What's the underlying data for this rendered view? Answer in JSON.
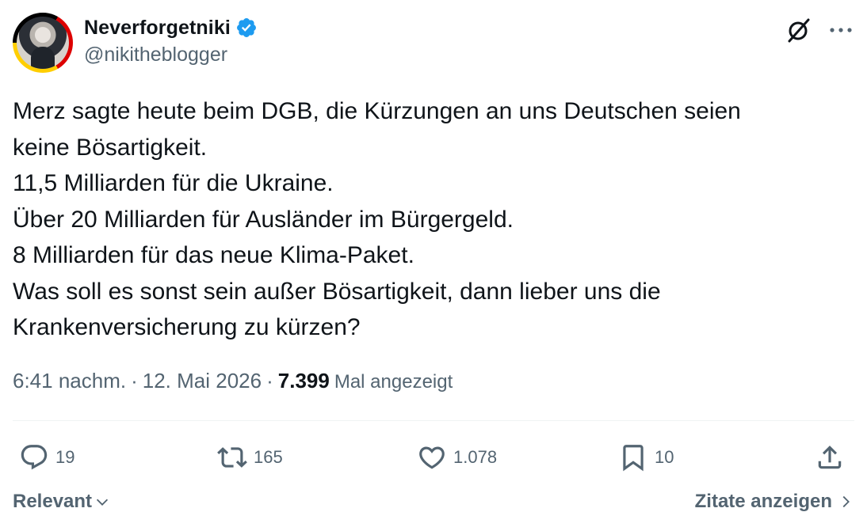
{
  "author": {
    "display_name": "Neverforgetniki",
    "handle": "@nikitheblogger",
    "verified": true
  },
  "tweet": {
    "text": "Merz sagte heute beim DGB, die Kürzungen an uns Deutschen seien\nkeine Bösartigkeit.\n11,5 Milliarden für die Ukraine.\nÜber 20 Milliarden für Ausländer im Bürgergeld.\n8 Milliarden für das neue Klima-Paket.\nWas soll es sonst sein außer Bösartigkeit, dann lieber uns die\nKrankenversicherung zu kürzen?",
    "time": "6:41 nachm.",
    "separator": "·",
    "date": "12. Mai 2026",
    "views_count": "7.399",
    "views_label": "Mal angezeigt"
  },
  "actions": {
    "replies": "19",
    "reposts": "165",
    "likes": "1.078",
    "bookmarks": "10"
  },
  "footer": {
    "sort_label": "Relevant",
    "quotes_label": "Zitate anzeigen"
  },
  "icons": {
    "verified": "verified-badge-icon",
    "grok": "grok-icon",
    "more": "more-icon",
    "reply": "reply-icon",
    "repost": "repost-icon",
    "like": "heart-icon",
    "bookmark": "bookmark-icon",
    "share": "share-icon"
  },
  "colors": {
    "verified_blue": "#1d9bf0",
    "text_primary": "#0f1419",
    "text_secondary": "#536471"
  }
}
